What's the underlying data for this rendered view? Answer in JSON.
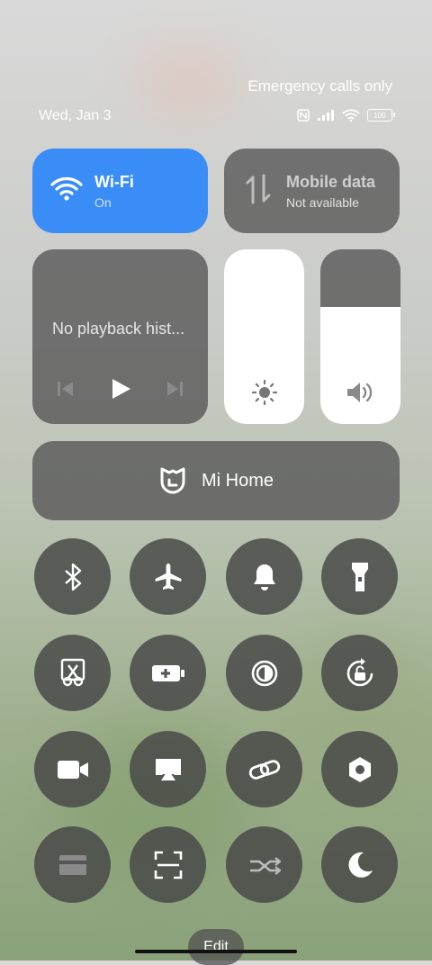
{
  "status": {
    "carrier_text": "Emergency calls only",
    "date": "Wed, Jan 3",
    "battery": "100"
  },
  "wifi_tile": {
    "title": "Wi-Fi",
    "subtitle": "On"
  },
  "mobile_data_tile": {
    "title": "Mobile data",
    "subtitle": "Not available"
  },
  "media": {
    "label": "No playback hist..."
  },
  "sliders": {
    "brightness_level": 1.0,
    "volume_level": 0.67
  },
  "mi_home": {
    "label": "Mi Home"
  },
  "toggles": [
    "bluetooth-icon",
    "airplane-icon",
    "bell-icon",
    "flashlight-icon",
    "scissors-icon",
    "battery-saver-icon",
    "contrast-icon",
    "rotation-lock-icon",
    "video-icon",
    "cast-icon",
    "link-icon",
    "settings-hex-icon",
    "card-icon",
    "scan-icon",
    "sync-icon",
    "moon-icon"
  ],
  "edit": {
    "label": "Edit"
  },
  "colors": {
    "accent": "#3a8df6"
  }
}
